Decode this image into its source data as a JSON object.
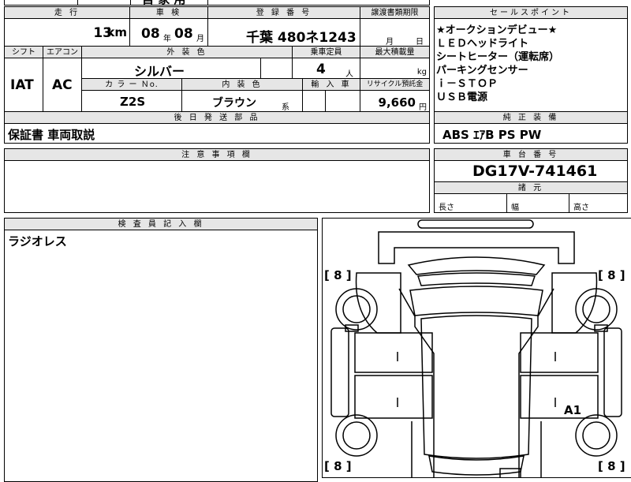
{
  "top_strip": {
    "partial_text": "自 家 用"
  },
  "mileage": {
    "label": "走 行",
    "value": "13",
    "unit": "km"
  },
  "inspection": {
    "label": "車 検",
    "year": "08",
    "year_unit": "年",
    "month": "08",
    "month_unit": "月"
  },
  "registration": {
    "label": "登 録 番 号",
    "value": "千葉 480ネ1243"
  },
  "transfer": {
    "label": "譲渡書類期限",
    "month_unit": "月",
    "day_unit": "日"
  },
  "shift": {
    "label": "シフト",
    "value": "IAT"
  },
  "aircon": {
    "label": "エアコン",
    "value": "AC"
  },
  "exterior": {
    "label": "外 装 色",
    "value": "シルバー"
  },
  "capacity": {
    "label": "乗車定員",
    "value": "4",
    "unit": "人"
  },
  "max_load": {
    "label": "最大積載量",
    "unit": "kg"
  },
  "color_no": {
    "label": "カ ラ ー Ｎo.",
    "value": "Z2S"
  },
  "interior": {
    "label": "内 装 色",
    "value": "ブラウン",
    "suffix": "系"
  },
  "import": {
    "label": "輸 入 車"
  },
  "recycle": {
    "label": "リサイクル預託金",
    "value": "9,660",
    "unit": "円"
  },
  "later_parts": {
    "label": "後 日 発 送 部 品",
    "value": "保証書 車両取説"
  },
  "notes": {
    "label": "注 意 事 項 欄",
    "value": ""
  },
  "sales_points": {
    "label": "セールスポイント",
    "items": [
      "★オークションデビュー★",
      "ＬＥＤヘッドライト",
      "シートヒーター（運転席）",
      "パーキングセンサー",
      "ｉ－ＳＴＯＰ",
      "ＵＳＢ電源"
    ]
  },
  "equipment": {
    "label": "純 正 装 備",
    "value": "ABS ｴｱB PS PW"
  },
  "chassis": {
    "label": "車 台 番 号",
    "value": "DG17V-741461"
  },
  "dimensions": {
    "label": "諸 元",
    "length": "長さ",
    "width": "幅",
    "height": "高さ"
  },
  "inspector": {
    "label": "検 査 員 記 入 欄",
    "value": "ラジオレス"
  },
  "diagram": {
    "tire_tl": "[ 8 ]",
    "tire_tr": "[ 8 ]",
    "tire_bl": "[ 8 ]",
    "tire_br": "[ 8 ]",
    "damage_mark": "A1"
  }
}
